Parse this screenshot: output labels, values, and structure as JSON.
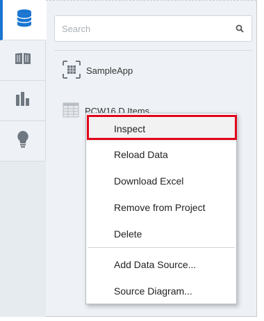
{
  "rail": {
    "items": [
      {
        "icon": "database-icon"
      },
      {
        "icon": "book-icon"
      },
      {
        "icon": "bar-chart-icon"
      },
      {
        "icon": "lightbulb-icon"
      }
    ],
    "accent": "#1a75d1"
  },
  "search": {
    "placeholder": "Search"
  },
  "tree": {
    "items": [
      {
        "label": "SampleApp",
        "icon": "subject-area-icon"
      },
      {
        "label": "PCW16 D Items",
        "icon": "table-icon"
      }
    ]
  },
  "context_menu": {
    "items": [
      "Inspect",
      "Reload Data",
      "Download Excel",
      "Remove from Project",
      "Delete",
      "Add Data Source...",
      "Source Diagram..."
    ],
    "highlight_color": "#e2001a"
  }
}
